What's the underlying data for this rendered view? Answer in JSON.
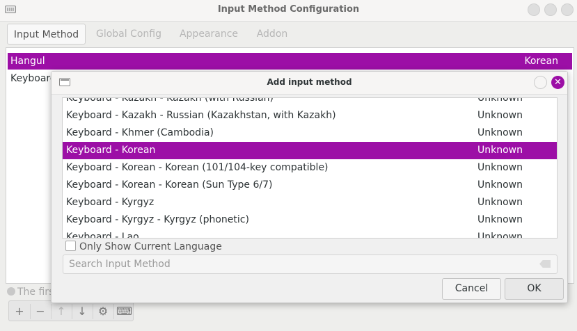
{
  "window": {
    "title": "Input Method Configuration"
  },
  "tabs": [
    {
      "label": "Input Method"
    },
    {
      "label": "Global Config"
    },
    {
      "label": "Appearance"
    },
    {
      "label": "Addon"
    }
  ],
  "im_list": {
    "header_left": "Hangul",
    "header_right": "Korean",
    "row1": "Keyboard"
  },
  "hint": "The first",
  "dialog": {
    "title": "Add input method",
    "rows": [
      {
        "name": "Keyboard - Kazakh - Kazakh (with Russian)",
        "lang": "Unknown"
      },
      {
        "name": "Keyboard - Kazakh - Russian (Kazakhstan, with Kazakh)",
        "lang": "Unknown"
      },
      {
        "name": "Keyboard - Khmer (Cambodia)",
        "lang": "Unknown"
      },
      {
        "name": "Keyboard - Korean",
        "lang": "Unknown"
      },
      {
        "name": "Keyboard - Korean - Korean (101/104-key compatible)",
        "lang": "Unknown"
      },
      {
        "name": "Keyboard - Korean - Korean (Sun Type 6/7)",
        "lang": "Unknown"
      },
      {
        "name": "Keyboard - Kyrgyz",
        "lang": "Unknown"
      },
      {
        "name": "Keyboard - Kyrgyz - Kyrgyz (phonetic)",
        "lang": "Unknown"
      },
      {
        "name": "Keyboard - Lao",
        "lang": "Unknown"
      }
    ],
    "selected_index": 3,
    "only_current_language_label": "Only Show Current Language",
    "search_placeholder": "Search Input Method",
    "cancel_label": "Cancel",
    "ok_label": "OK"
  },
  "colors": {
    "accent": "#9c0fa6"
  }
}
